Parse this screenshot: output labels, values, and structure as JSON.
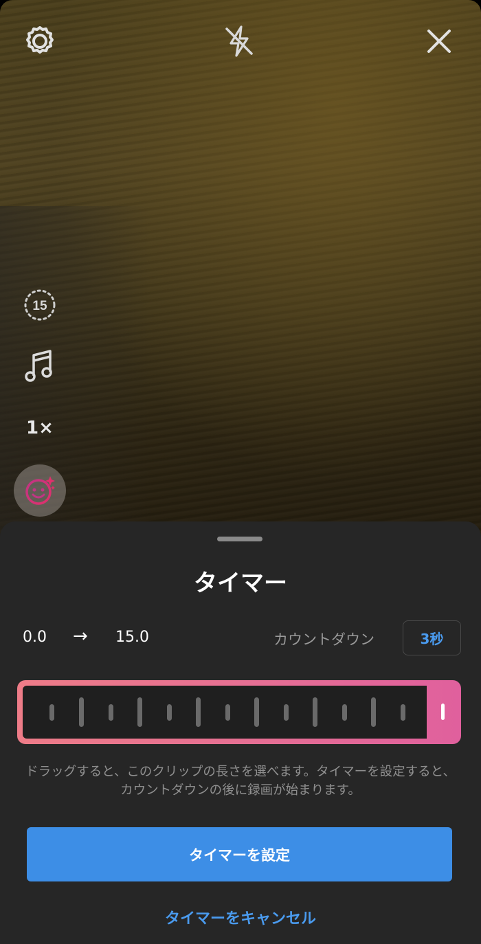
{
  "camera": {
    "speed_label": "1×",
    "duration_label": "15"
  },
  "sheet": {
    "title": "タイマー",
    "range_start": "0.0",
    "range_arrow": "→",
    "range_end": "15.0",
    "countdown_label": "カウントダウン",
    "countdown_value": "3秒",
    "hint": "ドラッグすると、このクリップの長さを選べます。タイマーを設定すると、カウントダウンの後に録画が始まります。",
    "set_button": "タイマーを設定",
    "cancel_button": "タイマーをキャンセル"
  },
  "colors": {
    "accent_blue": "#3d8ee6",
    "link_blue": "#4a9bef",
    "trimmer_pink": "#e56d95",
    "sheet_bg": "#262626"
  },
  "icons": [
    "settings-icon",
    "flash-off-icon",
    "close-icon",
    "duration-icon",
    "music-icon",
    "effects-icon"
  ]
}
